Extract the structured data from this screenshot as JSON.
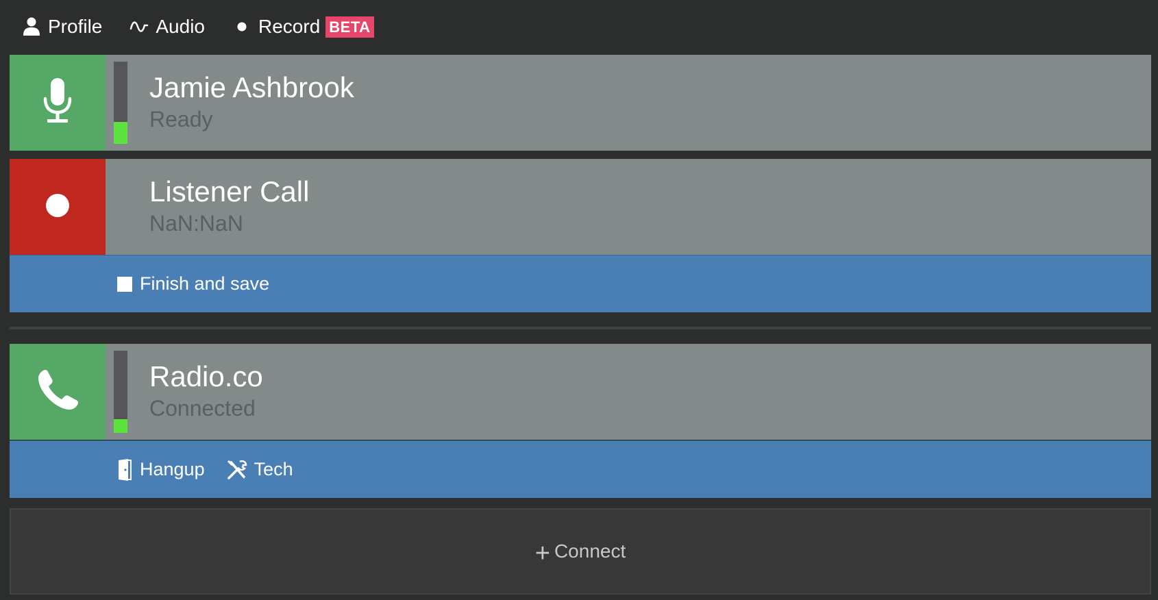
{
  "nav": {
    "profile_label": "Profile",
    "audio_label": "Audio",
    "record_label": "Record",
    "record_badge": "BETA"
  },
  "host": {
    "name": "Jamie Ashbrook",
    "status": "Ready",
    "level": 0.27,
    "icon": "microphone-icon"
  },
  "listener": {
    "name": "Listener Call",
    "status": "NaN:NaN",
    "icon": "record-dot-icon",
    "finish_label": "Finish and save"
  },
  "caller": {
    "name": "Radio.co",
    "status": "Connected",
    "level": 0.17,
    "icon": "phone-icon",
    "hangup_label": "Hangup",
    "tech_label": "Tech"
  },
  "connect": {
    "label": "Connect",
    "plus": "+"
  },
  "colors": {
    "green": "#55a866",
    "red": "#c0281f",
    "blue": "#4a7fb5",
    "card_gray": "#838a8a",
    "meter_green": "#5ee23f",
    "beta_pink": "#e8456b"
  }
}
